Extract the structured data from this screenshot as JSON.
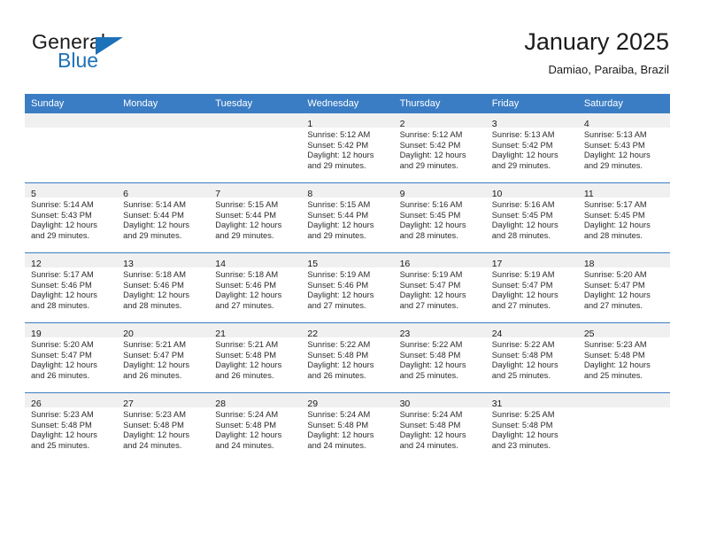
{
  "brand": {
    "name_top": "General",
    "name_bottom": "Blue",
    "triangle_icon": "blue-triangle-logo-mark",
    "color_primary": "#1d71b8",
    "color_text": "#1b1b1b"
  },
  "header": {
    "title": "January 2025",
    "subtitle": "Damiao, Paraiba, Brazil"
  },
  "theme": {
    "header_bg": "#3b7dc4",
    "date_band_bg": "#f0f0f0",
    "grid_line": "#3b7dc4",
    "page_bg": "#ffffff"
  },
  "calendar": {
    "weekday_headers": [
      "Sunday",
      "Monday",
      "Tuesday",
      "Wednesday",
      "Thursday",
      "Friday",
      "Saturday"
    ],
    "labels": {
      "sunrise_prefix": "Sunrise:",
      "sunset_prefix": "Sunset:",
      "daylight_prefix": "Daylight:"
    },
    "weeks": [
      [
        {
          "day": "",
          "empty": true
        },
        {
          "day": "",
          "empty": true
        },
        {
          "day": "",
          "empty": true
        },
        {
          "day": "1",
          "sunrise": "Sunrise: 5:12 AM",
          "sunset": "Sunset: 5:42 PM",
          "daylight_line1": "Daylight: 12 hours",
          "daylight_line2": "and 29 minutes."
        },
        {
          "day": "2",
          "sunrise": "Sunrise: 5:12 AM",
          "sunset": "Sunset: 5:42 PM",
          "daylight_line1": "Daylight: 12 hours",
          "daylight_line2": "and 29 minutes."
        },
        {
          "day": "3",
          "sunrise": "Sunrise: 5:13 AM",
          "sunset": "Sunset: 5:42 PM",
          "daylight_line1": "Daylight: 12 hours",
          "daylight_line2": "and 29 minutes."
        },
        {
          "day": "4",
          "sunrise": "Sunrise: 5:13 AM",
          "sunset": "Sunset: 5:43 PM",
          "daylight_line1": "Daylight: 12 hours",
          "daylight_line2": "and 29 minutes."
        }
      ],
      [
        {
          "day": "5",
          "sunrise": "Sunrise: 5:14 AM",
          "sunset": "Sunset: 5:43 PM",
          "daylight_line1": "Daylight: 12 hours",
          "daylight_line2": "and 29 minutes."
        },
        {
          "day": "6",
          "sunrise": "Sunrise: 5:14 AM",
          "sunset": "Sunset: 5:44 PM",
          "daylight_line1": "Daylight: 12 hours",
          "daylight_line2": "and 29 minutes."
        },
        {
          "day": "7",
          "sunrise": "Sunrise: 5:15 AM",
          "sunset": "Sunset: 5:44 PM",
          "daylight_line1": "Daylight: 12 hours",
          "daylight_line2": "and 29 minutes."
        },
        {
          "day": "8",
          "sunrise": "Sunrise: 5:15 AM",
          "sunset": "Sunset: 5:44 PM",
          "daylight_line1": "Daylight: 12 hours",
          "daylight_line2": "and 29 minutes."
        },
        {
          "day": "9",
          "sunrise": "Sunrise: 5:16 AM",
          "sunset": "Sunset: 5:45 PM",
          "daylight_line1": "Daylight: 12 hours",
          "daylight_line2": "and 28 minutes."
        },
        {
          "day": "10",
          "sunrise": "Sunrise: 5:16 AM",
          "sunset": "Sunset: 5:45 PM",
          "daylight_line1": "Daylight: 12 hours",
          "daylight_line2": "and 28 minutes."
        },
        {
          "day": "11",
          "sunrise": "Sunrise: 5:17 AM",
          "sunset": "Sunset: 5:45 PM",
          "daylight_line1": "Daylight: 12 hours",
          "daylight_line2": "and 28 minutes."
        }
      ],
      [
        {
          "day": "12",
          "sunrise": "Sunrise: 5:17 AM",
          "sunset": "Sunset: 5:46 PM",
          "daylight_line1": "Daylight: 12 hours",
          "daylight_line2": "and 28 minutes."
        },
        {
          "day": "13",
          "sunrise": "Sunrise: 5:18 AM",
          "sunset": "Sunset: 5:46 PM",
          "daylight_line1": "Daylight: 12 hours",
          "daylight_line2": "and 28 minutes."
        },
        {
          "day": "14",
          "sunrise": "Sunrise: 5:18 AM",
          "sunset": "Sunset: 5:46 PM",
          "daylight_line1": "Daylight: 12 hours",
          "daylight_line2": "and 27 minutes."
        },
        {
          "day": "15",
          "sunrise": "Sunrise: 5:19 AM",
          "sunset": "Sunset: 5:46 PM",
          "daylight_line1": "Daylight: 12 hours",
          "daylight_line2": "and 27 minutes."
        },
        {
          "day": "16",
          "sunrise": "Sunrise: 5:19 AM",
          "sunset": "Sunset: 5:47 PM",
          "daylight_line1": "Daylight: 12 hours",
          "daylight_line2": "and 27 minutes."
        },
        {
          "day": "17",
          "sunrise": "Sunrise: 5:19 AM",
          "sunset": "Sunset: 5:47 PM",
          "daylight_line1": "Daylight: 12 hours",
          "daylight_line2": "and 27 minutes."
        },
        {
          "day": "18",
          "sunrise": "Sunrise: 5:20 AM",
          "sunset": "Sunset: 5:47 PM",
          "daylight_line1": "Daylight: 12 hours",
          "daylight_line2": "and 27 minutes."
        }
      ],
      [
        {
          "day": "19",
          "sunrise": "Sunrise: 5:20 AM",
          "sunset": "Sunset: 5:47 PM",
          "daylight_line1": "Daylight: 12 hours",
          "daylight_line2": "and 26 minutes."
        },
        {
          "day": "20",
          "sunrise": "Sunrise: 5:21 AM",
          "sunset": "Sunset: 5:47 PM",
          "daylight_line1": "Daylight: 12 hours",
          "daylight_line2": "and 26 minutes."
        },
        {
          "day": "21",
          "sunrise": "Sunrise: 5:21 AM",
          "sunset": "Sunset: 5:48 PM",
          "daylight_line1": "Daylight: 12 hours",
          "daylight_line2": "and 26 minutes."
        },
        {
          "day": "22",
          "sunrise": "Sunrise: 5:22 AM",
          "sunset": "Sunset: 5:48 PM",
          "daylight_line1": "Daylight: 12 hours",
          "daylight_line2": "and 26 minutes."
        },
        {
          "day": "23",
          "sunrise": "Sunrise: 5:22 AM",
          "sunset": "Sunset: 5:48 PM",
          "daylight_line1": "Daylight: 12 hours",
          "daylight_line2": "and 25 minutes."
        },
        {
          "day": "24",
          "sunrise": "Sunrise: 5:22 AM",
          "sunset": "Sunset: 5:48 PM",
          "daylight_line1": "Daylight: 12 hours",
          "daylight_line2": "and 25 minutes."
        },
        {
          "day": "25",
          "sunrise": "Sunrise: 5:23 AM",
          "sunset": "Sunset: 5:48 PM",
          "daylight_line1": "Daylight: 12 hours",
          "daylight_line2": "and 25 minutes."
        }
      ],
      [
        {
          "day": "26",
          "sunrise": "Sunrise: 5:23 AM",
          "sunset": "Sunset: 5:48 PM",
          "daylight_line1": "Daylight: 12 hours",
          "daylight_line2": "and 25 minutes."
        },
        {
          "day": "27",
          "sunrise": "Sunrise: 5:23 AM",
          "sunset": "Sunset: 5:48 PM",
          "daylight_line1": "Daylight: 12 hours",
          "daylight_line2": "and 24 minutes."
        },
        {
          "day": "28",
          "sunrise": "Sunrise: 5:24 AM",
          "sunset": "Sunset: 5:48 PM",
          "daylight_line1": "Daylight: 12 hours",
          "daylight_line2": "and 24 minutes."
        },
        {
          "day": "29",
          "sunrise": "Sunrise: 5:24 AM",
          "sunset": "Sunset: 5:48 PM",
          "daylight_line1": "Daylight: 12 hours",
          "daylight_line2": "and 24 minutes."
        },
        {
          "day": "30",
          "sunrise": "Sunrise: 5:24 AM",
          "sunset": "Sunset: 5:48 PM",
          "daylight_line1": "Daylight: 12 hours",
          "daylight_line2": "and 24 minutes."
        },
        {
          "day": "31",
          "sunrise": "Sunrise: 5:25 AM",
          "sunset": "Sunset: 5:48 PM",
          "daylight_line1": "Daylight: 12 hours",
          "daylight_line2": "and 23 minutes."
        },
        {
          "day": "",
          "empty": true
        }
      ]
    ]
  }
}
